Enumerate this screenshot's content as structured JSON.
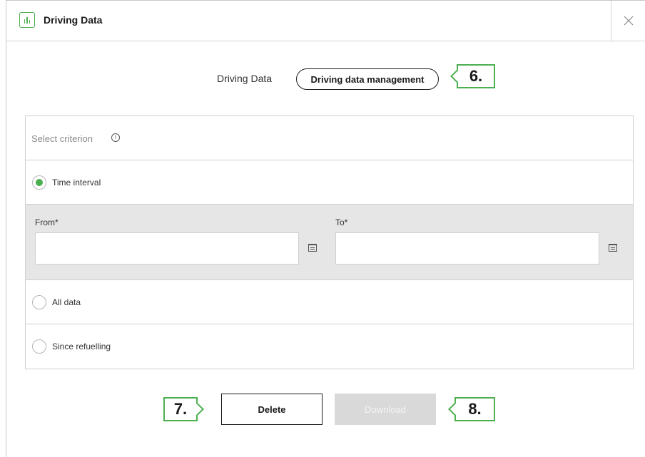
{
  "header": {
    "title": "Driving Data"
  },
  "tabs": {
    "driving_data": "Driving Data",
    "management": "Driving data management"
  },
  "criterion": {
    "label": "Select criterion",
    "info_symbol": "i",
    "options": [
      {
        "label": "Time interval",
        "selected": true
      },
      {
        "label": "All data",
        "selected": false
      },
      {
        "label": "Since refuelling",
        "selected": false
      }
    ],
    "from_label": "From*",
    "to_label": "To*",
    "from_value": "",
    "to_value": ""
  },
  "actions": {
    "delete": "Delete",
    "download": "Download",
    "download_disabled": true
  },
  "callouts": {
    "c6": "6.",
    "c7": "7.",
    "c8": "8."
  },
  "colors": {
    "accent": "#4caf50",
    "disabled": "#d9d9d9",
    "range_bg": "#e6e6e6"
  },
  "icons": [
    "chart-icon",
    "close-icon",
    "info-icon",
    "calendar-icon"
  ]
}
